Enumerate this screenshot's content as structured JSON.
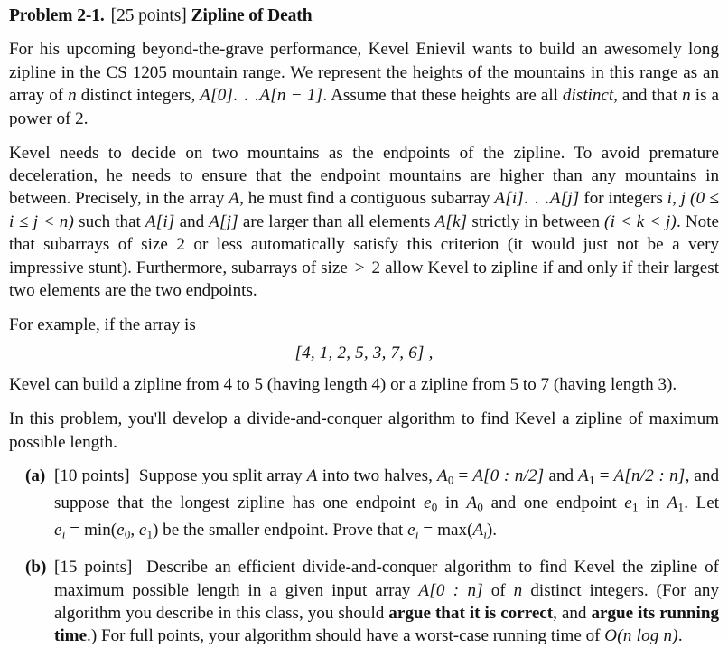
{
  "document": {
    "type": "problem-set-page",
    "background_color": "#ffffff",
    "text_color": "#141414"
  },
  "heading": {
    "problem_label": "Problem 2-1.",
    "points": "[25 points]",
    "title": "Zipline of Death"
  },
  "paragraphs": {
    "p1_a": "For his upcoming beyond-the-grave performance, Kevel Enievil wants to build an awesomely long zipline in the CS 1205 mountain range. We represent the heights of the mountains in this range as an array of ",
    "p1_b": " distinct integers, ",
    "p1_c": ". Assume that these heights are all ",
    "p1_distinct": "distinct",
    "p1_d": ", and that ",
    "p1_e": " is a power of 2.",
    "p2_a": "Kevel needs to decide on two mountains as the endpoints of the zipline. To avoid premature deceleration, he needs to ensure that the endpoint mountains are higher than any mountains in between. Precisely, in the array ",
    "p2_b": ", he must find a contiguous subarray ",
    "p2_c": " for integers ",
    "p2_d": ", ",
    "p2_e": " such that ",
    "p2_f": " and ",
    "p2_g": " are larger than all elements ",
    "p2_h": " strictly in between ",
    "p2_i": ". Note that subarrays of size 2 or less automatically satisfy this criterion (it would just not be a very impressive stunt). Furthermore, subarrays of size ",
    "p2_j": " 2 allow Kevel to zipline if and only if their largest two elements are the two endpoints.",
    "p3": "For example, if the array is",
    "p4": "Kevel can build a zipline from 4 to 5 (having length 4) or a zipline from 5 to 7 (having length 3).",
    "p5": "In this problem, you'll develop a divide-and-conquer algorithm to find Kevel a zipline of maximum possible length."
  },
  "math": {
    "n": "n",
    "A": "A",
    "A0_bracket": "A[0]",
    "dots": ". . .",
    "An_minus_1": "A[n − 1]",
    "A_i_bracket": "A[i]",
    "A_j_bracket": "A[j]",
    "A_k_bracket": "A[k]",
    "i": "i",
    "j": "j",
    "k": "k",
    "range_condition": "(0 ≤ i ≤ j < n)",
    "between_condition": "(i < k < j)",
    "greater_than": ">",
    "example_array": "[4, 1, 2, 5, 3, 7, 6] ,",
    "A_sub_0": "A",
    "A_sub_1": "A",
    "split_low": "A[0 : n/2]",
    "split_high": "A[n/2 : n]",
    "e_0": "e",
    "e_1": "e",
    "e_i": "e",
    "min_expr": "min(e0, e1)",
    "max_expr": "max(Ai)",
    "input_array": "A[0 : n]",
    "running_time": "O(n log n)"
  },
  "subparts": [
    {
      "marker": "(a)",
      "points": "[10 points]",
      "text_a": "Suppose you split array ",
      "text_b": " into two halves, ",
      "text_c": " and ",
      "text_d": ", and suppose that the longest zipline has one endpoint ",
      "text_e": " in ",
      "text_f": " and one endpoint ",
      "text_g": " in ",
      "text_h": ". Let ",
      "text_i": " be the smaller endpoint. Prove that ",
      "text_j": "."
    },
    {
      "marker": "(b)",
      "points": "[15 points]",
      "text_a": "Describe an efficient divide-and-conquer algorithm to find Kevel the zipline of maximum possible length in a given input array ",
      "text_b": " of ",
      "text_c": " distinct integers. (For any algorithm you describe in this class, you should ",
      "bold_1": "argue that it is correct",
      "text_d": ", and ",
      "bold_2": "argue its running time",
      "text_e": ".) For full points, your algorithm should have a worst-case running time of ",
      "text_f": "."
    }
  ]
}
